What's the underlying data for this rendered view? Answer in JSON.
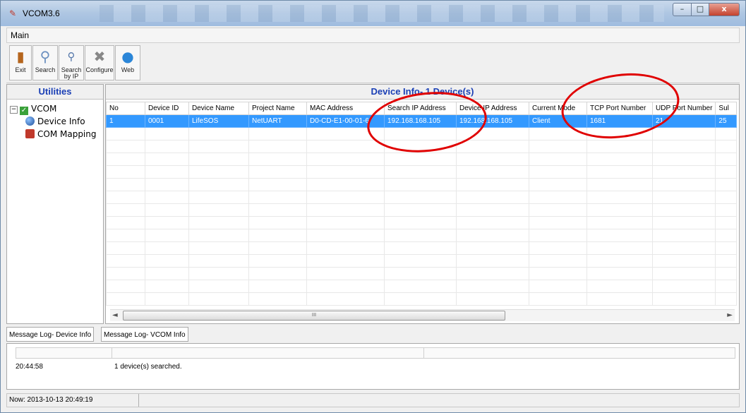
{
  "window": {
    "title": "VCOM3.6",
    "minimize": "–",
    "maximize": "□",
    "close": "x"
  },
  "menu": {
    "main_label": "Main"
  },
  "toolbar": {
    "buttons": [
      {
        "label": "Exit",
        "icon": "door-icon"
      },
      {
        "label": "Search",
        "icon": "magnifier-icon"
      },
      {
        "label": "Search by IP",
        "icon": "network-search-icon"
      },
      {
        "label": "Configure",
        "icon": "tools-icon"
      },
      {
        "label": "Web",
        "icon": "globe-icon"
      }
    ]
  },
  "sidebar": {
    "heading": "Utilities",
    "tree": {
      "root": "VCOM",
      "root_expander": "−",
      "items": [
        "Device Info",
        "COM Mapping"
      ]
    }
  },
  "device_info": {
    "heading": "Device Info- 1 Device(s)",
    "columns": [
      "No",
      "Device ID",
      "Device Name",
      "Project Name",
      "MAC Address",
      "Search IP Address",
      "Device IP Address",
      "Current Mode",
      "TCP Port Number",
      "UDP Port Number",
      "Sul"
    ],
    "rows": [
      [
        "1",
        "0001",
        "LifeSOS",
        "NetUART",
        "D0-CD-E1-00-01-6",
        "192.168.168.105",
        "192.168.168.105",
        "Client",
        "1681",
        "21",
        "25"
      ]
    ],
    "scroll_left": "◄",
    "scroll_right": "►",
    "scroll_grip": "III"
  },
  "log": {
    "tabs": [
      "Message Log- Device Info",
      "Message Log- VCOM Info"
    ],
    "entries": [
      {
        "time": "20:44:58",
        "message": "1 device(s) searched."
      }
    ]
  },
  "status": {
    "now": "Now: 2013-10-13 20:49:19"
  },
  "colors": {
    "accent_blue": "#1a3fb5",
    "selection": "#3399ff",
    "annotation_red": "#e00000"
  }
}
